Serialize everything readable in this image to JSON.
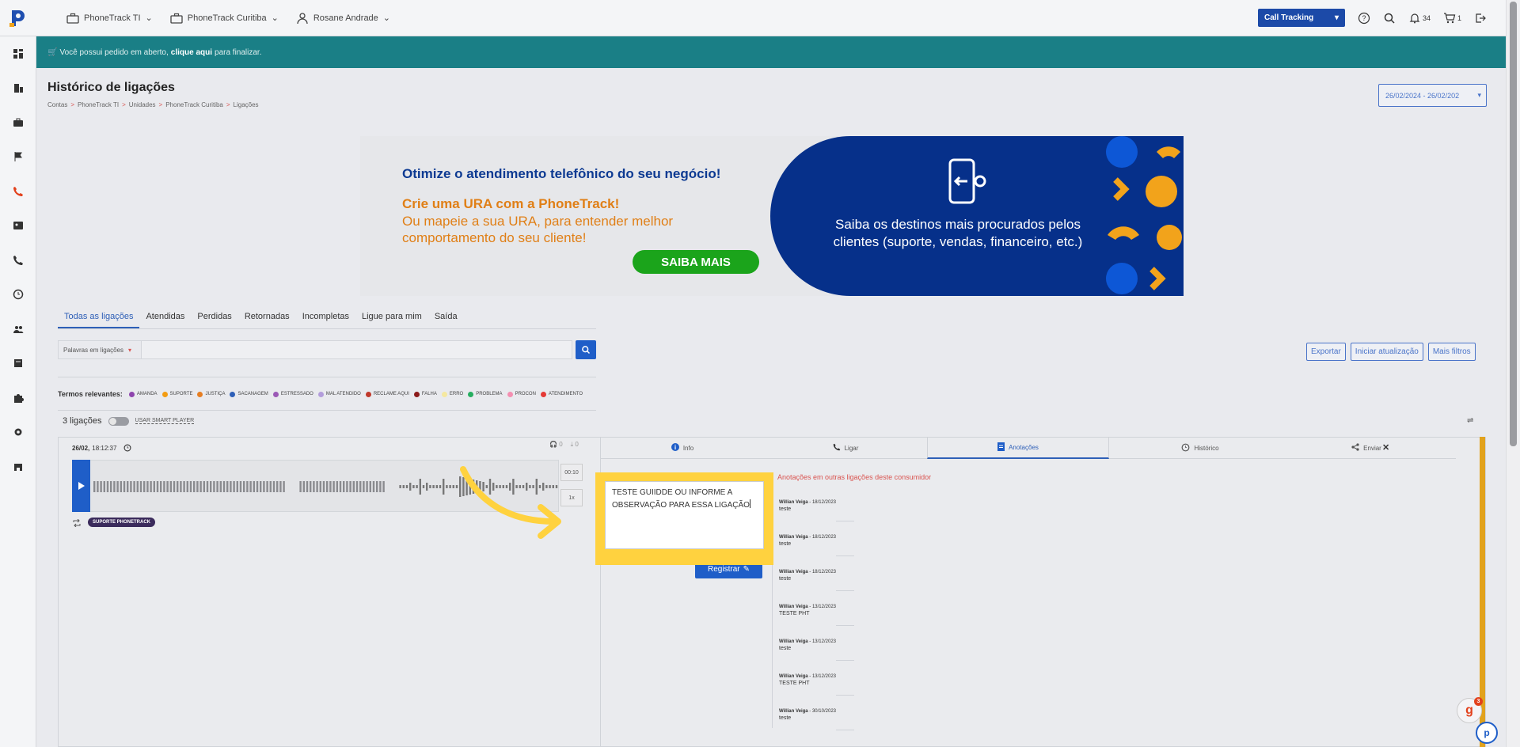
{
  "topbar": {
    "nav": [
      {
        "label": "PhoneTrack TI",
        "icon": "briefcase-icon"
      },
      {
        "label": "PhoneTrack Curitiba",
        "icon": "briefcase-icon"
      },
      {
        "label": "Rosane Andrade",
        "icon": "user-icon"
      }
    ],
    "product_select": "Call Tracking",
    "notifications_count": "34",
    "cart_count": "1"
  },
  "notice": {
    "prefix": "Você possui pedido em aberto,",
    "link": "clique aqui",
    "suffix": "para finalizar."
  },
  "page": {
    "title": "Histórico de ligações",
    "breadcrumb": [
      "Contas",
      "PhoneTrack TI",
      "Unidades",
      "PhoneTrack Curitiba",
      "Ligações"
    ],
    "date_range": "26/02/2024 - 26/02/202"
  },
  "banner": {
    "line1": "Otimize o atendimento telefônico do seu negócio!",
    "line2": "Crie uma URA com a PhoneTrack!",
    "line3": "Ou mapeie a sua URA, para entender melhor comportamento do seu cliente!",
    "cta": "SAIBA MAIS",
    "right_text": "Saiba os destinos mais procurados pelos clientes (suporte, vendas, financeiro, etc.)"
  },
  "tabs": [
    "Todas as ligações",
    "Atendidas",
    "Perdidas",
    "Retornadas",
    "Incompletas",
    "Ligue para mim",
    "Saída"
  ],
  "search": {
    "select_label": "Palavras em ligações",
    "value": ""
  },
  "actions": [
    "Exportar",
    "Iniciar atualização",
    "Mais filtros"
  ],
  "terms": {
    "label": "Termos relevantes:",
    "items": [
      {
        "label": "AMANDA",
        "color": "#8e44ad"
      },
      {
        "label": "SUPORTE",
        "color": "#f39c12"
      },
      {
        "label": "JUSTIÇA",
        "color": "#e67e22"
      },
      {
        "label": "SACANAGEM",
        "color": "#2e5fb7"
      },
      {
        "label": "ESTRESSADO",
        "color": "#9b59b6"
      },
      {
        "label": "MAL ATENDIDO",
        "color": "#b39ddb"
      },
      {
        "label": "RECLAME AQUI",
        "color": "#c0392b"
      },
      {
        "label": "FALHA",
        "color": "#8b1a1a"
      },
      {
        "label": "ERRO",
        "color": "#f5e8a0"
      },
      {
        "label": "PROBLEMA",
        "color": "#27ae60"
      },
      {
        "label": "PROCON",
        "color": "#f48fb1"
      },
      {
        "label": "ATENDIMENTO",
        "color": "#e53935"
      }
    ]
  },
  "calls": {
    "count_label": "3 ligações",
    "smart_player": "USAR SMART PLAYER"
  },
  "call": {
    "date": "26/02,",
    "time": "18:12:37",
    "listens": "0",
    "downloads": "0",
    "duration": "00:10",
    "speed": "1x",
    "tag": "SUPORTE PHONETRACK"
  },
  "detail_tabs": [
    {
      "label": "Info",
      "icon": "info-icon"
    },
    {
      "label": "Ligar",
      "icon": "phone-icon"
    },
    {
      "label": "Anotações",
      "icon": "notes-icon"
    },
    {
      "label": "Histórico",
      "icon": "history-icon"
    },
    {
      "label": "Enviar",
      "icon": "share-icon"
    }
  ],
  "annotation": {
    "text": "TESTE GUIIDDE OU INFORME A OBSERVAÇÃO PARA ESSA LIGAÇÃO",
    "submit": "Registrar",
    "others_title": "Anotações em outras ligações deste consumidor",
    "notes": [
      {
        "author": "Willian Veiga",
        "date": "18/12/2023",
        "text": "teste"
      },
      {
        "author": "Willian Veiga",
        "date": "18/12/2023",
        "text": "teste"
      },
      {
        "author": "Willian Veiga",
        "date": "18/12/2023",
        "text": "teste"
      },
      {
        "author": "Willian Veiga",
        "date": "13/12/2023",
        "text": "TESTE PHT"
      },
      {
        "author": "Willian Veiga",
        "date": "13/12/2023",
        "text": "teste"
      },
      {
        "author": "Willian Veiga",
        "date": "13/12/2023",
        "text": "TESTE PHT"
      },
      {
        "author": "Willian Veiga",
        "date": "30/10/2023",
        "text": "teste"
      }
    ]
  },
  "widget_badge": "3"
}
